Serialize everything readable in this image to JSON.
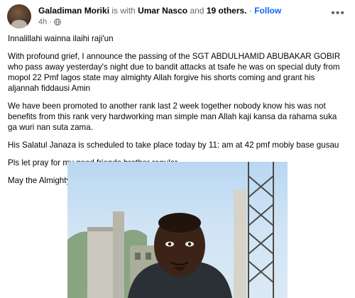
{
  "post": {
    "author": "Galadiman Moriki",
    "is_with_text": "is with",
    "tagged_person": "Umar Nasco",
    "and_text": "and",
    "others": "19 others.",
    "separator": "·",
    "follow_label": "Follow",
    "timestamp": "4h",
    "meta_separator": "·",
    "more_icon": "more-options-icon",
    "privacy_icon": "globe-icon",
    "paragraphs": [
      "Innalillahi wainna ilaihi raji'un",
      "With profound grief, I announce the passing of the SGT ABDULHAMID ABUBAKAR GOBIR  who pass away yesterday's night due to bandit attacks at tsafe he was on special duty from mopol 22 Pmf lagos state  may almighty Allah forgive his shorts coming and grant his aljannah fiddausi Amin",
      "We have been promoted to another rank last 2 week together  nobody know his was not benefits from this rank very hardworking man simple man Allah kaji kansa da rahama suka ga wuri nan suta zama.",
      "His Salatul Janaza is scheduled to take place today by 11: am at 42 pmf mobiy base gusau",
      "Pls let pray for my good friends brother regular",
      "May the Almighty Allah grant him Jannatul Firdaus. Ameennd"
    ]
  },
  "colors": {
    "link_blue": "#0866ff",
    "muted_gray": "#65676b",
    "text": "#050505"
  }
}
